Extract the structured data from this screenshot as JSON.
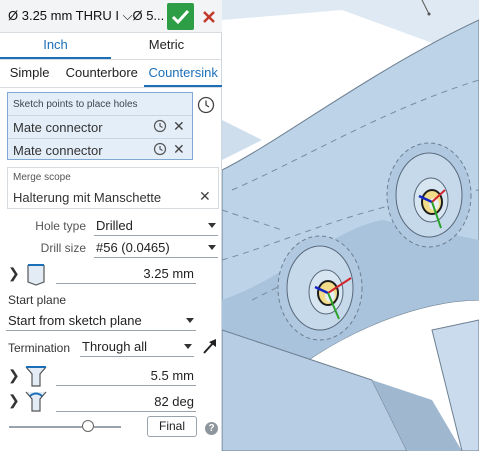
{
  "title": "Ø 3.25 mm THRU I ⌵Ø 5....",
  "units": {
    "options": [
      "Inch",
      "Metric"
    ],
    "selected": "Inch"
  },
  "hole_style": {
    "options": [
      "Simple",
      "Counterbore",
      "Countersink"
    ],
    "selected": "Countersink"
  },
  "selection": {
    "heading": "Sketch points to place holes",
    "items": [
      "Mate connector",
      "Mate connector"
    ]
  },
  "merge_scope": {
    "heading": "Merge scope",
    "value": "Halterung mit Manschette"
  },
  "hole_type": {
    "label": "Hole type",
    "value": "Drilled"
  },
  "drill_size": {
    "label": "Drill size",
    "value": "#56 (0.0465)"
  },
  "diameter": {
    "value": "3.25 mm"
  },
  "start_plane": {
    "label": "Start plane",
    "value": "Start from sketch plane"
  },
  "termination": {
    "label": "Termination",
    "value": "Through all"
  },
  "csink_diameter": {
    "value": "5.5 mm"
  },
  "csink_angle": {
    "value": "82 deg"
  },
  "final_button": "Final",
  "help": "?",
  "colors": {
    "accent": "#1b6fb8",
    "accept": "#2e9e46",
    "cancel": "#c0392b",
    "part": "#bcd3e8"
  }
}
